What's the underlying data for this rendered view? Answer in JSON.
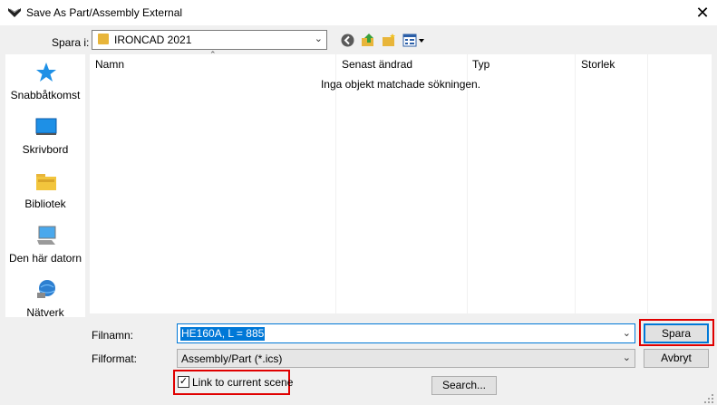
{
  "window": {
    "title": "Save As Part/Assembly External",
    "close_glyph": "✕"
  },
  "lookin": {
    "label": "Spara i:",
    "value": "IRONCAD 2021"
  },
  "toolbar": {
    "icons": [
      "back-icon",
      "up-folder-icon",
      "new-folder-icon",
      "view-menu-icon"
    ]
  },
  "places": [
    {
      "label": "Snabbåtkomst",
      "icon": "star-icon"
    },
    {
      "label": "Skrivbord",
      "icon": "desktop-icon"
    },
    {
      "label": "Bibliotek",
      "icon": "library-icon"
    },
    {
      "label": "Den här datorn",
      "icon": "computer-icon"
    },
    {
      "label": "Nätverk",
      "icon": "network-icon"
    }
  ],
  "filelist": {
    "columns": [
      "Namn",
      "Senast ändrad",
      "Typ",
      "Storlek"
    ],
    "empty_message": "Inga objekt matchade sökningen."
  },
  "filename": {
    "label": "Filnamn:",
    "value": "HE160A, L = 885"
  },
  "filetype": {
    "label": "Filformat:",
    "value": "Assembly/Part (*.ics)"
  },
  "buttons": {
    "save": "Spara",
    "cancel": "Avbryt",
    "search": "Search..."
  },
  "link_scene": {
    "label": "Link to current scene",
    "checked": true
  },
  "colors": {
    "accent": "#0078d7",
    "highlight_box": "#e00000"
  }
}
